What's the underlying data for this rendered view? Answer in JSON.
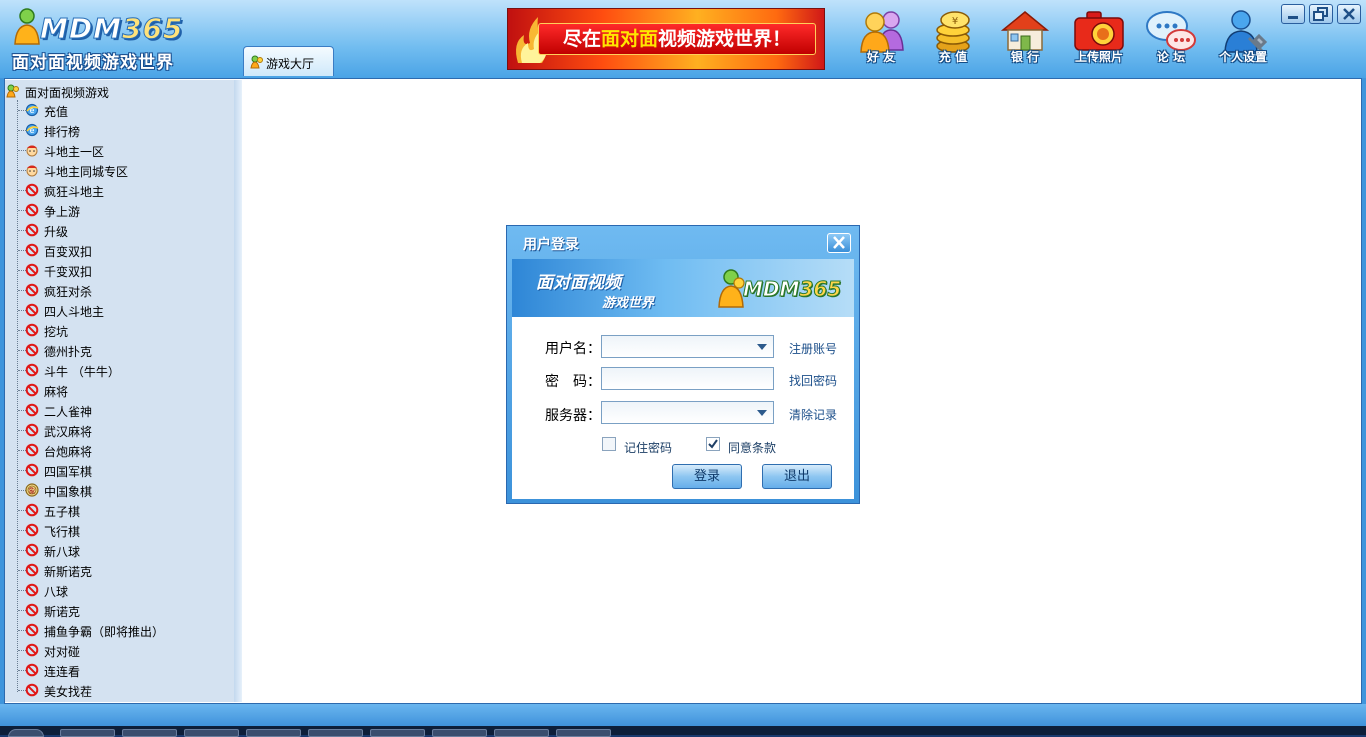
{
  "app": {
    "logo_text": "MDM",
    "logo_number": "365",
    "logo_subtitle": "面对面视频游戏世界"
  },
  "banner": {
    "text_before": "尽在",
    "text_highlight": "面对面",
    "text_after": "视频游戏世界！"
  },
  "toolbar": [
    {
      "label": "好 友",
      "icon": "friends-icon"
    },
    {
      "label": "充 值",
      "icon": "coins-icon"
    },
    {
      "label": "银 行",
      "icon": "bank-icon"
    },
    {
      "label": "上传照片",
      "icon": "camera-icon"
    },
    {
      "label": "论 坛",
      "icon": "forum-icon"
    },
    {
      "label": "个人设置",
      "icon": "user-settings-icon"
    }
  ],
  "tab": {
    "label": "游戏大厅"
  },
  "tree": {
    "root": "面对面视频游戏",
    "items": [
      {
        "label": "充值",
        "icon": "ie"
      },
      {
        "label": "排行榜",
        "icon": "ie"
      },
      {
        "label": "斗地主一区",
        "icon": "face"
      },
      {
        "label": "斗地主同城专区",
        "icon": "face"
      },
      {
        "label": "疯狂斗地主",
        "icon": "ban"
      },
      {
        "label": "争上游",
        "icon": "ban"
      },
      {
        "label": "升级",
        "icon": "ban"
      },
      {
        "label": "百变双扣",
        "icon": "ban"
      },
      {
        "label": "千变双扣",
        "icon": "ban"
      },
      {
        "label": "疯狂对杀",
        "icon": "ban"
      },
      {
        "label": "四人斗地主",
        "icon": "ban"
      },
      {
        "label": "挖坑",
        "icon": "ban"
      },
      {
        "label": "德州扑克",
        "icon": "ban"
      },
      {
        "label": "斗牛 （牛牛）",
        "icon": "ban"
      },
      {
        "label": "麻将",
        "icon": "ban"
      },
      {
        "label": "二人雀神",
        "icon": "ban"
      },
      {
        "label": "武汉麻将",
        "icon": "ban"
      },
      {
        "label": "台炮麻将",
        "icon": "ban"
      },
      {
        "label": "四国军棋",
        "icon": "ban"
      },
      {
        "label": "中国象棋",
        "icon": "chess"
      },
      {
        "label": "五子棋",
        "icon": "ban"
      },
      {
        "label": "飞行棋",
        "icon": "ban"
      },
      {
        "label": "新八球",
        "icon": "ban"
      },
      {
        "label": "新斯诺克",
        "icon": "ban"
      },
      {
        "label": "八球",
        "icon": "ban"
      },
      {
        "label": "斯诺克",
        "icon": "ban"
      },
      {
        "label": "捕鱼争霸（即将推出）",
        "icon": "ban"
      },
      {
        "label": "对对碰",
        "icon": "ban"
      },
      {
        "label": "连连看",
        "icon": "ban"
      },
      {
        "label": "美女找茬",
        "icon": "ban"
      }
    ]
  },
  "login": {
    "title": "用户登录",
    "banner_line1": "面对面视频",
    "banner_line2": "游戏世界",
    "banner_logo": "MDM",
    "banner_logo_number": "365",
    "username_label": "用户名：",
    "password_label": "密　码：",
    "server_label": "服务器：",
    "register_link": "注册账号",
    "recover_link": "找回密码",
    "clear_link": "清除记录",
    "remember_label": "记住密码",
    "remember_checked": false,
    "agree_label": "同意条款",
    "agree_checked": true,
    "login_button": "登录",
    "exit_button": "退出"
  },
  "colors": {
    "frame_blue": "#4aa3e6",
    "sidebar_bg": "#d4e2f1",
    "ban_red": "#e01818",
    "link_blue": "#1c4f8a"
  }
}
